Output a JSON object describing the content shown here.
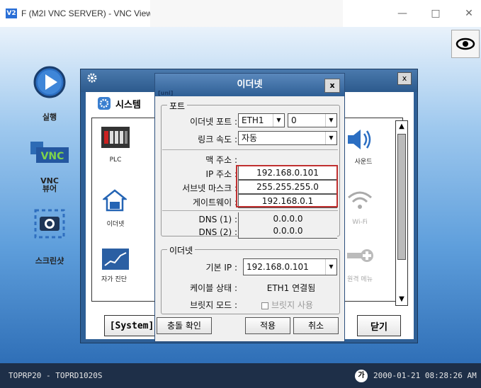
{
  "window": {
    "title": "F (M2I VNC SERVER) - VNC Viewer",
    "logo_text": "V2",
    "minimize": "—",
    "maximize": "□",
    "close": "✕"
  },
  "sidebar": {
    "items": [
      {
        "label": "실행",
        "icon": "play-icon"
      },
      {
        "label": "",
        "icon": "vnc-icon"
      },
      {
        "label": "VNC\n뷰어",
        "icon": "vnc-viewer-icon"
      },
      {
        "label": "",
        "icon": "camera-icon"
      },
      {
        "label": "스크린샷",
        "icon": "screenshot-icon"
      }
    ]
  },
  "system_window": {
    "tab_label": "시스템",
    "close": "x",
    "grid_items": [
      "PLC",
      "이더넷",
      "자가 진단",
      "사운드",
      "Wi-Fi",
      "원격 메뉴"
    ],
    "system_button": "[System]",
    "close_button": "닫기"
  },
  "ethernet_dialog": {
    "title": "이더넷",
    "close": "x",
    "logo": "[uni]",
    "port_group": {
      "title": "포트",
      "ethernet_port_label": "이더넷 포트 :",
      "ethernet_port_value": "ETH1",
      "ethernet_port_index": "0",
      "link_speed_label": "링크 속도 :",
      "link_speed_value": "자동",
      "mac_label": "맥 주소 :",
      "ip_label": "IP 주소 :",
      "ip_value": "192.168.0.101",
      "subnet_label": "서브넷 마스크 :",
      "subnet_value": "255.255.255.0",
      "gateway_label": "게이트웨이 :",
      "gateway_value": "192.168.0.1",
      "dns1_label": "DNS (1) :",
      "dns1_value": "0.0.0.0",
      "dns2_label": "DNS (2) :",
      "dns2_value": "0.0.0.0"
    },
    "ethernet_group": {
      "title": "이더넷",
      "default_ip_label": "기본 IP :",
      "default_ip_value": "192.168.0.101",
      "cable_label": "케이블 상태 :",
      "cable_value": "ETH1 연결됨",
      "bridge_label": "브릿지 모드 :",
      "bridge_value": "브릿지 사용"
    },
    "buttons": {
      "conflict_check": "충돌 확인",
      "apply": "적용",
      "cancel": "취소"
    }
  },
  "status_bar": {
    "left": "TOPRP20 - TOPRD1020S",
    "ime": "가",
    "datetime": "2000-01-21 08:28:26 AM"
  },
  "colors": {
    "titlebar_blue": "#2f5f95",
    "highlight_red": "#c03030",
    "status_bg": "#1e2f48"
  }
}
